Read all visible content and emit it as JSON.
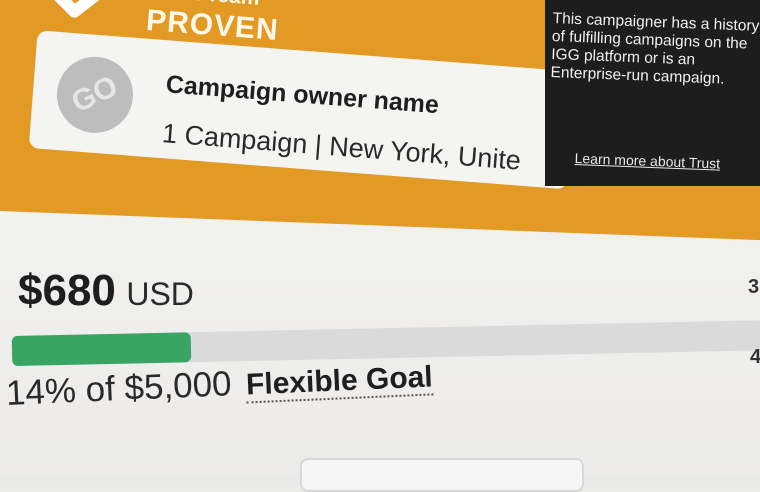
{
  "trust": {
    "label": "Trust Team",
    "status": "PROVEN",
    "icon": "check-icon",
    "accent_color": "#e29a25"
  },
  "owner": {
    "logo_text": "GO",
    "name": "Campaign owner name",
    "meta": "1 Campaign | New York, Unite"
  },
  "tooltip": {
    "text": "This campaigner has a history of fulfilling campaigns on the IGG platform or is an Enterprise-run campaign.",
    "link": "Learn more about Trust"
  },
  "funding": {
    "amount": "$680",
    "currency": "USD",
    "progress_percent": 14,
    "goal_text": "14% of $5,000",
    "goal_type": "Flexible Goal",
    "progress_color": "#3aa464"
  },
  "edge": {
    "char_top": "3",
    "char_bottom": "4"
  }
}
